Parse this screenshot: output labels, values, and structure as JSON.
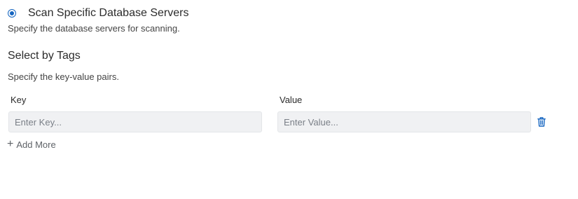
{
  "scan_option": {
    "label": "Scan Specific Database Servers",
    "selected": true,
    "description": "Specify the database servers for scanning."
  },
  "tags_section": {
    "title": "Select by Tags",
    "description": "Specify the key-value pairs.",
    "key_label": "Key",
    "value_label": "Value",
    "key_placeholder": "Enter Key...",
    "value_placeholder": "Enter Value...",
    "add_more_label": "Add More"
  },
  "icons": {
    "delete": "trash-icon",
    "add": "plus-icon"
  },
  "colors": {
    "accent": "#1565c0",
    "input_bg": "#f0f1f3"
  }
}
